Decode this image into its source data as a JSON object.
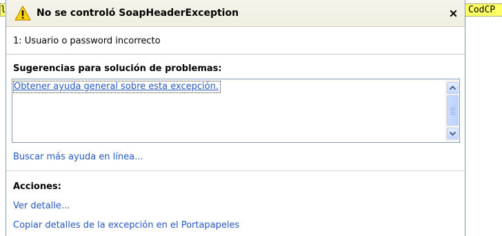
{
  "background_code": {
    "left_fragment": "l",
    "right_fragment": "CodCP"
  },
  "dialog": {
    "title": "No se controló SoapHeaderException",
    "icon": "warning-icon",
    "close_icon": "close-icon",
    "message": "1: Usuario o password incorrecto"
  },
  "tips": {
    "heading": "Sugerencias para solución de problemas:",
    "items": [
      {
        "label": "Obtener ayuda general sobre esta excepción."
      }
    ],
    "more_help_link": "Buscar más ayuda en línea..."
  },
  "actions": {
    "heading": "Acciones:",
    "items": [
      {
        "label": "Ver detalle..."
      },
      {
        "label": "Copiar detalles de la excepción en el Portapapeles"
      }
    ]
  },
  "colors": {
    "link": "#2659c2",
    "title_bar_bg": "#f0eee0",
    "highlight": "#ffff66",
    "border": "#7f9db9",
    "warning_yellow": "#ffd200"
  }
}
